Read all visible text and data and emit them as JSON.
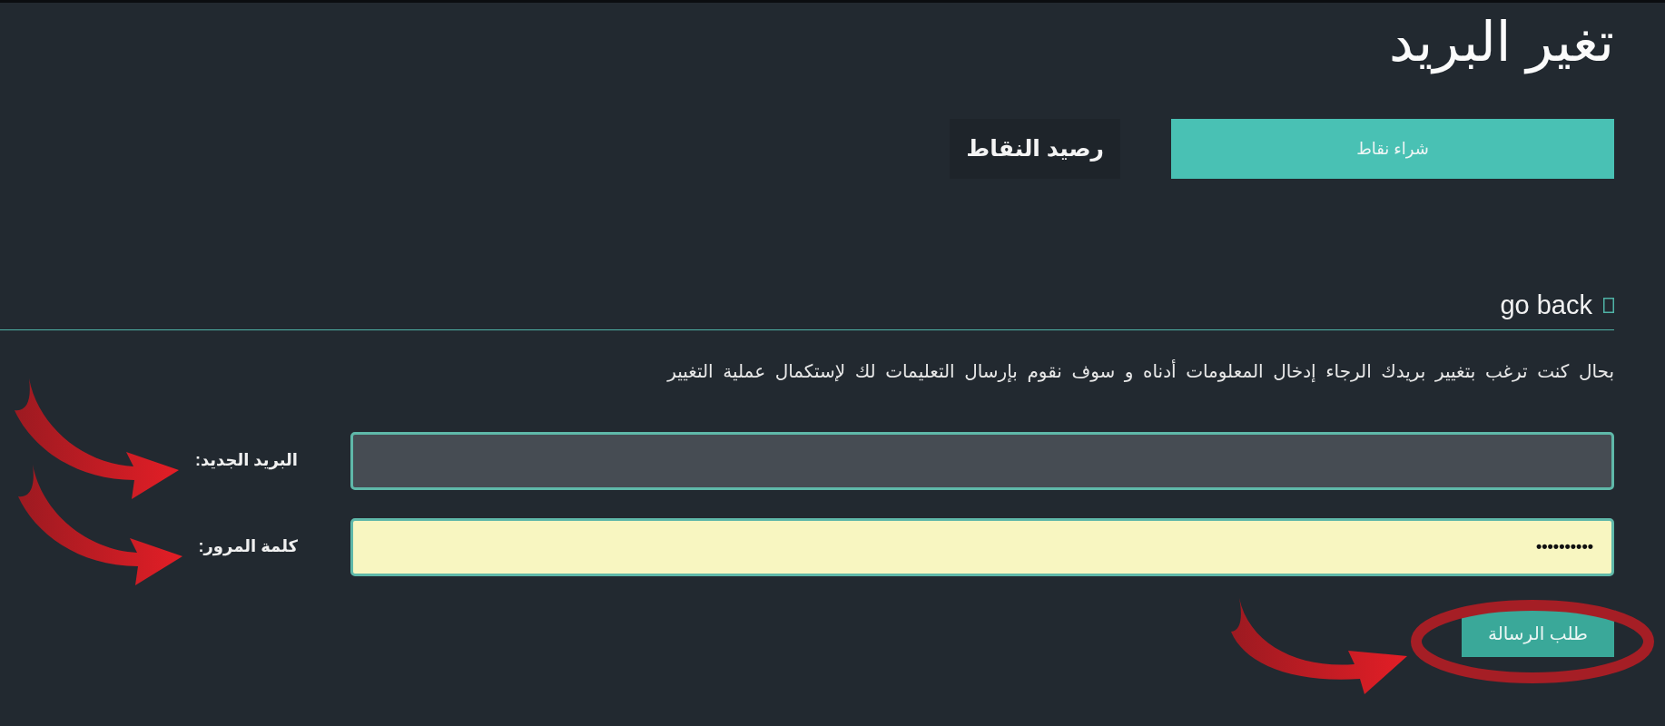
{
  "page": {
    "title": "تغير البريد"
  },
  "points": {
    "balance_label": "رصيد النقاط",
    "buy_button": "شراء نقاط"
  },
  "back_link": {
    "label": "go back"
  },
  "instructions": "بحال كنت ترغب بتغيير بريدك الرجاء إدخال المعلومات أدناه و سوف نقوم بإرسال التعليمات لك لإستكمال عملية التغيير",
  "form": {
    "fields": [
      {
        "label": "البريد الجديد:",
        "autofilled": false
      },
      {
        "label": "كلمة المرور:",
        "value": "••••••••••",
        "autofilled": true
      }
    ],
    "submit_button": "طلب الرسالة"
  }
}
